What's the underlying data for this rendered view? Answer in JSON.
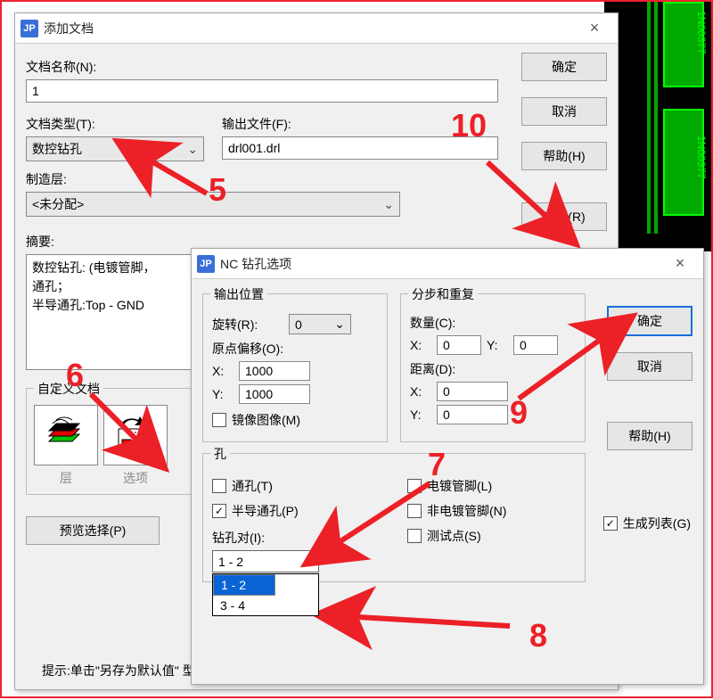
{
  "dialog1": {
    "title": "添加文档",
    "fields": {
      "doc_name_label": "文档名称(N):",
      "doc_name_value": "1",
      "doc_type_label": "文档类型(T):",
      "doc_type_value": "数控钻孔",
      "output_file_label": "输出文件(F):",
      "output_file_value": "drl001.drl",
      "mfg_layer_label": "制造层:",
      "mfg_layer_value": "<未分配>",
      "summary_label": "摘要:",
      "summary_text": "数控钻孔: (电镀管脚，\n通孔；\n半导通孔:Top - GND"
    },
    "custom_docs": {
      "group_label": "自定义文档",
      "layer_label": "层",
      "options_label": "选项"
    },
    "buttons": {
      "ok": "确定",
      "cancel": "取消",
      "help": "帮助(H)",
      "run": "运行(R)",
      "preview": "预览选择(P)"
    },
    "hint": "提示:单击\"另存为默认值\"\n          型和输出设备的默认"
  },
  "dialog2": {
    "title": "NC 钻孔选项",
    "output_pos": {
      "legend": "输出位置",
      "rotate_label": "旋转(R):",
      "rotate_value": "0",
      "origin_label": "原点偏移(O):",
      "x_label": "X:",
      "x_value": "1000",
      "y_label": "Y:",
      "y_value": "1000",
      "mirror_label": "镜像图像(M)"
    },
    "step_repeat": {
      "legend": "分步和重复",
      "count_label": "数量(C):",
      "count_x": "0",
      "count_y": "0",
      "dist_label": "距离(D):",
      "dist_x": "0",
      "dist_y": "0",
      "x_label": "X:",
      "y_label": "Y:"
    },
    "holes": {
      "legend": "孔",
      "through_label": "通孔(T)",
      "partial_label": "半导通孔(P)",
      "plated_label": "电镀管脚(L)",
      "nonplated_label": "非电镀管脚(N)",
      "testpoint_label": "测试点(S)",
      "drill_pair_label": "钻孔对(I):",
      "drill_pair_selected": "1 - 2",
      "drill_pair_options": [
        "1 - 2",
        "3 - 4"
      ]
    },
    "gen_list_label": "生成列表(G)",
    "buttons": {
      "ok": "确定",
      "cancel": "取消",
      "help": "帮助(H)"
    }
  },
  "annotations": {
    "n5": "5",
    "n6": "6",
    "n7": "7",
    "n8": "8",
    "n9": "9",
    "n10": "10"
  },
  "pcb": {
    "ref1": "1N00377",
    "ref2": "1N00377"
  }
}
